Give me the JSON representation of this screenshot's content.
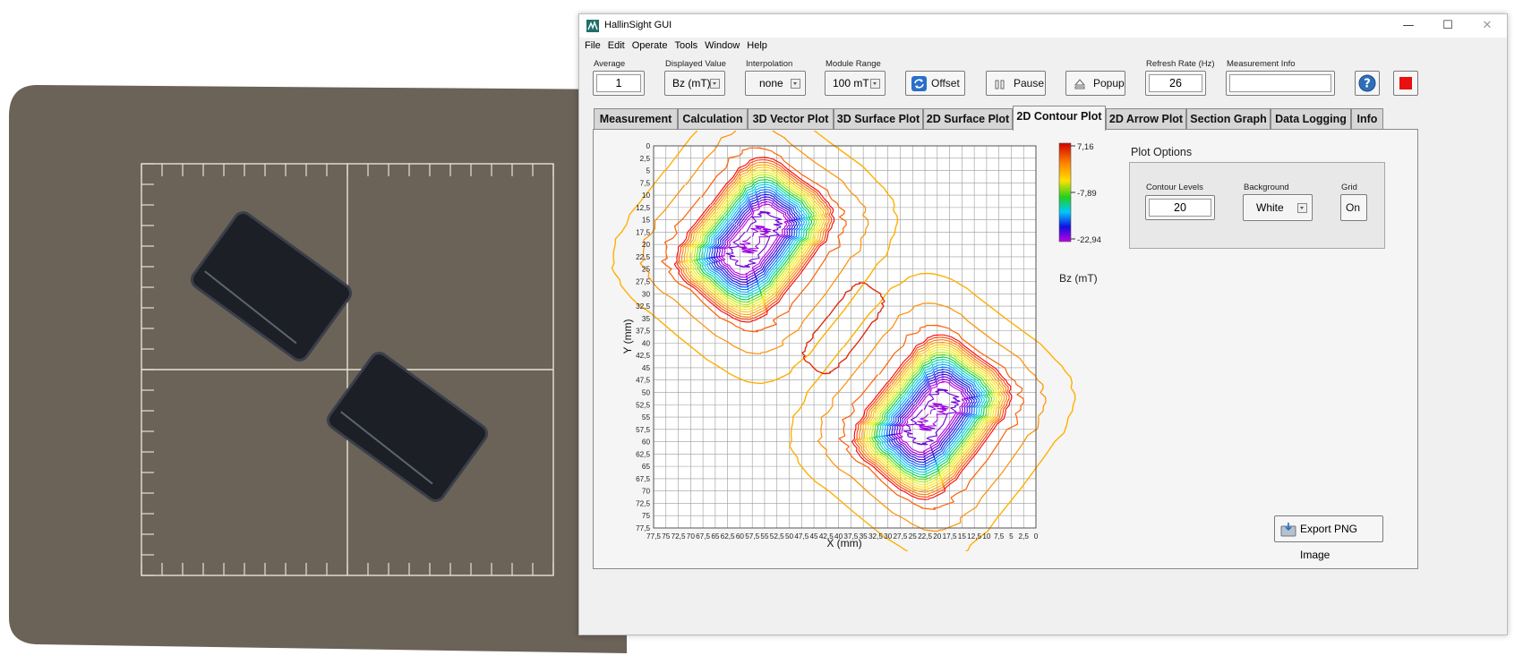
{
  "window": {
    "title": "HallinSight GUI",
    "controls": {
      "minimize": "—",
      "maximize": "☐",
      "close": "✕"
    }
  },
  "menu": [
    "File",
    "Edit",
    "Operate",
    "Tools",
    "Window",
    "Help"
  ],
  "toolbar": {
    "average": {
      "label": "Average",
      "value": "1"
    },
    "displayed_value": {
      "label": "Displayed Value",
      "value": "Bz (mT)"
    },
    "interpolation": {
      "label": "Interpolation",
      "value": "none"
    },
    "module_range": {
      "label": "Module Range",
      "value": "100 mT"
    },
    "offset_label": "Offset",
    "pause_label": "Pause",
    "popup_label": "Popup",
    "refresh_rate": {
      "label": "Refresh Rate (Hz)",
      "value": "26"
    },
    "measurement_info": {
      "label": "Measurement Info",
      "value": ""
    },
    "help_icon": "question-icon",
    "stop_icon": "stop-icon"
  },
  "tabs": [
    "Measurement",
    "Calculation",
    "3D Vector Plot",
    "3D Surface Plot",
    "2D Surface Plot",
    "2D Contour Plot",
    "2D Arrow Plot",
    "Section Graph",
    "Data Logging",
    "Info"
  ],
  "active_tab": "2D Contour Plot",
  "plot": {
    "xlabel": "X (mm)",
    "ylabel": "Y (mm)",
    "x_ticks": [
      "77,5",
      "75",
      "72,5",
      "70",
      "67,5",
      "65",
      "62,5",
      "60",
      "57,5",
      "55",
      "52,5",
      "50",
      "47,5",
      "45",
      "42,5",
      "40",
      "37,5",
      "35",
      "32,5",
      "30",
      "27,5",
      "25",
      "22,5",
      "20",
      "17,5",
      "15",
      "12,5",
      "10",
      "7,5",
      "5",
      "2,5",
      "0"
    ],
    "y_ticks": [
      "0",
      "2,5",
      "5",
      "7,5",
      "10",
      "12,5",
      "15",
      "17,5",
      "20",
      "22,5",
      "25",
      "27,5",
      "30",
      "32,5",
      "35",
      "37,5",
      "40",
      "42,5",
      "45",
      "47,5",
      "50",
      "52,5",
      "55",
      "57,5",
      "60",
      "62,5",
      "65",
      "67,5",
      "70",
      "72,5",
      "75",
      "77,5"
    ],
    "colorbar": {
      "max": "7,16",
      "mid": "-7,89",
      "min": "-22,94",
      "unit": "Bz (mT)"
    }
  },
  "plot_options": {
    "title": "Plot Options",
    "contour_levels": {
      "label": "Contour Levels",
      "value": "20"
    },
    "background": {
      "label": "Background",
      "value": "White"
    },
    "grid": {
      "label": "Grid",
      "value": "On"
    }
  },
  "export_label": "Export PNG Image",
  "colors": {
    "accent_blue": "#2a6fc9",
    "stop_red": "#e81010",
    "tab_active": "#f5f5f5"
  },
  "chart_data": {
    "type": "contour",
    "x_range": [
      77.5,
      0
    ],
    "y_range": [
      0,
      77.5
    ],
    "x_step": 2.5,
    "y_step": 2.5,
    "grid": true,
    "levels": 20,
    "z_min": -22.94,
    "z_mid": -7.89,
    "z_max": 7.16,
    "colorbar_unit": "Bz (mT)",
    "magnets": [
      {
        "name": "upper-left",
        "center": [
          57,
          19
        ],
        "half_width": 7,
        "half_height": 11,
        "rotation_deg": -38
      },
      {
        "name": "lower-right",
        "center": [
          21,
          55
        ],
        "half_width": 7,
        "half_height": 11,
        "rotation_deg": -38
      }
    ]
  }
}
